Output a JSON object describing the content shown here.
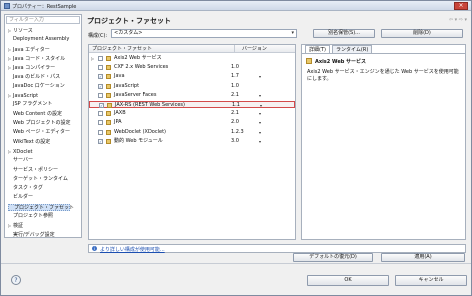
{
  "window": {
    "title": "プロパティー：RestSample"
  },
  "left": {
    "filter_placeholder": "フィルター入力",
    "tree": [
      {
        "label": "リソース",
        "expander": "▷",
        "indent": 0
      },
      {
        "label": "Deployment Assembly",
        "expander": "",
        "indent": 0
      },
      {
        "label": "Java エディター",
        "expander": "▷",
        "indent": 0
      },
      {
        "label": "Java コード・スタイル",
        "expander": "▷",
        "indent": 0
      },
      {
        "label": "Java コンパイラー",
        "expander": "▷",
        "indent": 0
      },
      {
        "label": "Java のビルド・パス",
        "expander": "",
        "indent": 0
      },
      {
        "label": "JavaDoc ロケーション",
        "expander": "",
        "indent": 0
      },
      {
        "label": "JavaScript",
        "expander": "▷",
        "indent": 0
      },
      {
        "label": "JSP フラグメント",
        "expander": "",
        "indent": 0
      },
      {
        "label": "Web Content の設定",
        "expander": "",
        "indent": 0
      },
      {
        "label": "Web プロジェクトの設定",
        "expander": "",
        "indent": 0
      },
      {
        "label": "Web ページ・エディター",
        "expander": "",
        "indent": 0
      },
      {
        "label": "WikiText の設定",
        "expander": "",
        "indent": 0
      },
      {
        "label": "XDoclet",
        "expander": "▷",
        "indent": 0
      },
      {
        "label": "サーバー",
        "expander": "",
        "indent": 0
      },
      {
        "label": "サービス・ポリシー",
        "expander": "",
        "indent": 0
      },
      {
        "label": "ターゲット・ランタイム",
        "expander": "",
        "indent": 0
      },
      {
        "label": "タスク・タグ",
        "expander": "",
        "indent": 0
      },
      {
        "label": "ビルダー",
        "expander": "",
        "indent": 0
      },
      {
        "label": "プロジェクト・ファセット",
        "expander": "",
        "indent": 0
      },
      {
        "label": "プロジェクト参照",
        "expander": "",
        "indent": 0
      },
      {
        "label": "検証",
        "expander": "▷",
        "indent": 0
      },
      {
        "label": "実行/デバッグ設定",
        "expander": "",
        "indent": 0
      }
    ],
    "selected_index": 19
  },
  "main": {
    "heading": "プロジェクト・ファセット",
    "nav_icons": "⇦ ▾ ⇨ ▾",
    "config_label": "構成(C):",
    "config_value": "<カスタム>",
    "save_as_button": "別名保管(S)...",
    "delete_button": "削除(D)",
    "table": {
      "col_facet": "プロジェクト・ファセット",
      "col_version": "バージョン",
      "rows": [
        {
          "name": "Axis2 Web サービス",
          "version": "",
          "checked": false,
          "expand": "▷",
          "dropdown": false
        },
        {
          "name": "CXF 2.x Web Services",
          "version": "1.0",
          "checked": false,
          "expand": "",
          "dropdown": false
        },
        {
          "name": "Java",
          "version": "1.7",
          "checked": true,
          "expand": "",
          "dropdown": true
        },
        {
          "name": "JavaScript",
          "version": "1.0",
          "checked": true,
          "expand": "",
          "dropdown": false
        },
        {
          "name": "JavaServer Faces",
          "version": "2.1",
          "checked": false,
          "expand": "",
          "dropdown": true
        },
        {
          "name": "JAX-RS (REST Web Services)",
          "version": "1.1",
          "checked": true,
          "expand": "",
          "dropdown": true
        },
        {
          "name": "JAXB",
          "version": "2.1",
          "checked": false,
          "expand": "",
          "dropdown": true
        },
        {
          "name": "JPA",
          "version": "2.0",
          "checked": false,
          "expand": "",
          "dropdown": true
        },
        {
          "name": "WebDoclet (XDoclet)",
          "version": "1.2.3",
          "checked": false,
          "expand": "",
          "dropdown": true
        },
        {
          "name": "動的 Web モジュール",
          "version": "3.0",
          "checked": true,
          "expand": "",
          "dropdown": true
        }
      ],
      "selected_row": 5
    },
    "detail": {
      "tab_details": "詳細(T)",
      "tab_runtime": "ランタイム(R)",
      "title": "Axis2 Web サービス",
      "description": "Axis2 Web サービス・エンジンを通じた Web サービスを使用可能にします。"
    },
    "info_link": "より詳しい構成が使用可能...",
    "restore_button": "デフォルトの復元(D)",
    "apply_button": "適用(A)"
  },
  "footer": {
    "help_label": "?",
    "ok_button": "OK",
    "cancel_button": "キャンセル"
  },
  "colors": {
    "selection_border": "#d34a4a",
    "link": "#1c4fb1",
    "checkbox_tick": "#1e5bb5"
  }
}
